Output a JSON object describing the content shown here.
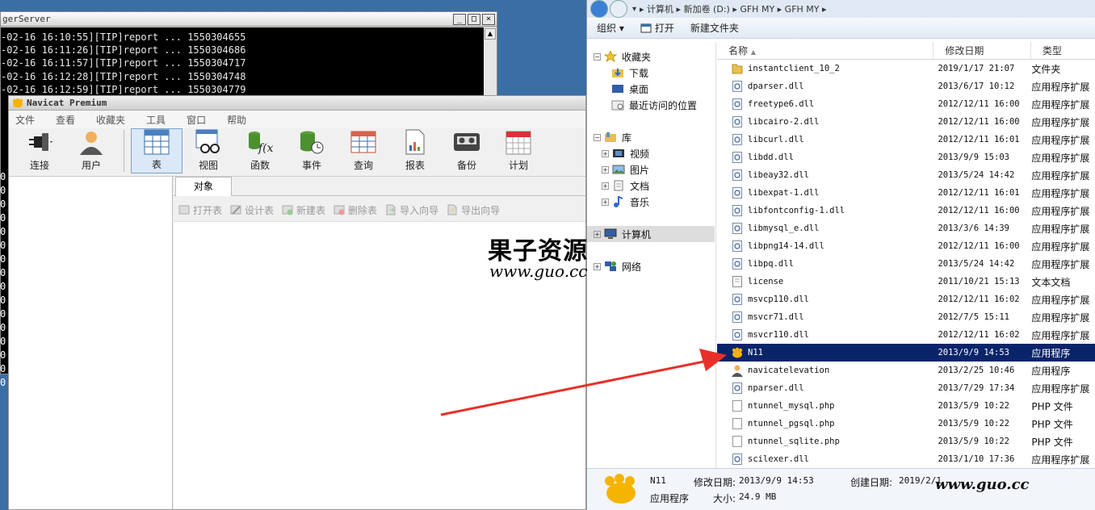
{
  "console": {
    "title": "gerServer",
    "lines": [
      "-02-16 16:10:55][TIP]report ... 1550304655",
      "-02-16 16:11:26][TIP]report ... 1550304686",
      "-02-16 16:11:57][TIP]report ... 1550304717",
      "-02-16 16:12:28][TIP]report ... 1550304748",
      "-02-16 16:12:59][TIP]report ... 1550304779"
    ],
    "fragment_char": "0",
    "window_buttons": [
      "_",
      "□",
      "×"
    ]
  },
  "navicat": {
    "title": "Navicat Premium",
    "menu": [
      "文件",
      "查看",
      "收藏夹",
      "工具",
      "窗口",
      "帮助"
    ],
    "toolbar": [
      {
        "label": "连接",
        "icon": "plug-icon"
      },
      {
        "label": "用户",
        "icon": "user-icon"
      },
      {
        "label": "表",
        "icon": "table-icon",
        "active": true
      },
      {
        "label": "视图",
        "icon": "view-icon"
      },
      {
        "label": "函数",
        "icon": "function-icon"
      },
      {
        "label": "事件",
        "icon": "event-icon"
      },
      {
        "label": "查询",
        "icon": "query-icon"
      },
      {
        "label": "报表",
        "icon": "report-icon"
      },
      {
        "label": "备份",
        "icon": "backup-icon"
      },
      {
        "label": "计划",
        "icon": "schedule-icon"
      }
    ],
    "tab_label": "对象",
    "object_actions": [
      "打开表",
      "设计表",
      "新建表",
      "删除表",
      "导入向导",
      "导出向导"
    ]
  },
  "explorer": {
    "breadcrumb": "▸ 计算机 ▸ 新加卷 (D:) ▸ GFH MY ▸ GFH MY ▸",
    "commands": [
      "组织 ▾",
      "打开",
      "新建文件夹"
    ],
    "nav": {
      "favorites": "收藏夹",
      "favorites_items": [
        "下载",
        "桌面",
        "最近访问的位置"
      ],
      "libraries": "库",
      "libraries_items": [
        "视频",
        "图片",
        "文档",
        "音乐"
      ],
      "computer": "计算机",
      "network": "网络"
    },
    "columns": [
      "名称",
      "修改日期",
      "类型"
    ],
    "files": [
      {
        "name": "instantclient_10_2",
        "date": "2019/1/17 21:07",
        "type": "文件夹",
        "icon": "folder-icon"
      },
      {
        "name": "dparser.dll",
        "date": "2013/6/17 10:12",
        "type": "应用程序扩展",
        "icon": "dll-icon"
      },
      {
        "name": "freetype6.dll",
        "date": "2012/12/11 16:00",
        "type": "应用程序扩展",
        "icon": "dll-icon"
      },
      {
        "name": "libcairo-2.dll",
        "date": "2012/12/11 16:00",
        "type": "应用程序扩展",
        "icon": "dll-icon"
      },
      {
        "name": "libcurl.dll",
        "date": "2012/12/11 16:01",
        "type": "应用程序扩展",
        "icon": "dll-icon"
      },
      {
        "name": "libdd.dll",
        "date": "2013/9/9 15:03",
        "type": "应用程序扩展",
        "icon": "dll-icon"
      },
      {
        "name": "libeay32.dll",
        "date": "2013/5/24 14:42",
        "type": "应用程序扩展",
        "icon": "dll-icon"
      },
      {
        "name": "libexpat-1.dll",
        "date": "2012/12/11 16:01",
        "type": "应用程序扩展",
        "icon": "dll-icon"
      },
      {
        "name": "libfontconfig-1.dll",
        "date": "2012/12/11 16:00",
        "type": "应用程序扩展",
        "icon": "dll-icon"
      },
      {
        "name": "libmysql_e.dll",
        "date": "2013/3/6 14:39",
        "type": "应用程序扩展",
        "icon": "dll-icon"
      },
      {
        "name": "libpng14-14.dll",
        "date": "2012/12/11 16:00",
        "type": "应用程序扩展",
        "icon": "dll-icon"
      },
      {
        "name": "libpq.dll",
        "date": "2013/5/24 14:42",
        "type": "应用程序扩展",
        "icon": "dll-icon"
      },
      {
        "name": "license",
        "date": "2011/10/21 15:13",
        "type": "文本文档",
        "icon": "text-file-icon"
      },
      {
        "name": "msvcp110.dll",
        "date": "2012/12/11 16:02",
        "type": "应用程序扩展",
        "icon": "dll-icon"
      },
      {
        "name": "msvcr71.dll",
        "date": "2012/7/5 15:11",
        "type": "应用程序扩展",
        "icon": "dll-icon"
      },
      {
        "name": "msvcr110.dll",
        "date": "2012/12/11 16:02",
        "type": "应用程序扩展",
        "icon": "dll-icon"
      },
      {
        "name": "N11",
        "date": "2013/9/9 14:53",
        "type": "应用程序",
        "icon": "navicat-icon",
        "selected": true
      },
      {
        "name": "navicatelevation",
        "date": "2013/2/25 10:46",
        "type": "应用程序",
        "icon": "user-app-icon"
      },
      {
        "name": "nparser.dll",
        "date": "2013/7/29 17:34",
        "type": "应用程序扩展",
        "icon": "dll-icon"
      },
      {
        "name": "ntunnel_mysql.php",
        "date": "2013/5/9 10:22",
        "type": "PHP 文件",
        "icon": "php-file-icon"
      },
      {
        "name": "ntunnel_pgsql.php",
        "date": "2013/5/9 10:22",
        "type": "PHP 文件",
        "icon": "php-file-icon"
      },
      {
        "name": "ntunnel_sqlite.php",
        "date": "2013/5/9 10:22",
        "type": "PHP 文件",
        "icon": "php-file-icon"
      },
      {
        "name": "scilexer.dll",
        "date": "2013/1/10 17:36",
        "type": "应用程序扩展",
        "icon": "dll-icon"
      }
    ],
    "details": {
      "name": "N11",
      "type": "应用程序",
      "modified_label": "修改日期:",
      "modified": "2013/9/9 14:53",
      "size_label": "大小:",
      "size": "24.9 MB",
      "created_label": "创建日期:",
      "created": "2019/2/1"
    }
  },
  "watermark": {
    "title": "果子资源",
    "url": "www.guo.cc",
    "url_bottom": "www.guo.cc"
  },
  "colors": {
    "selection": "#0a246a",
    "arrow": "#e8302a",
    "desktop": "#3a6ea5",
    "navicat_accent": "#f4b400"
  }
}
